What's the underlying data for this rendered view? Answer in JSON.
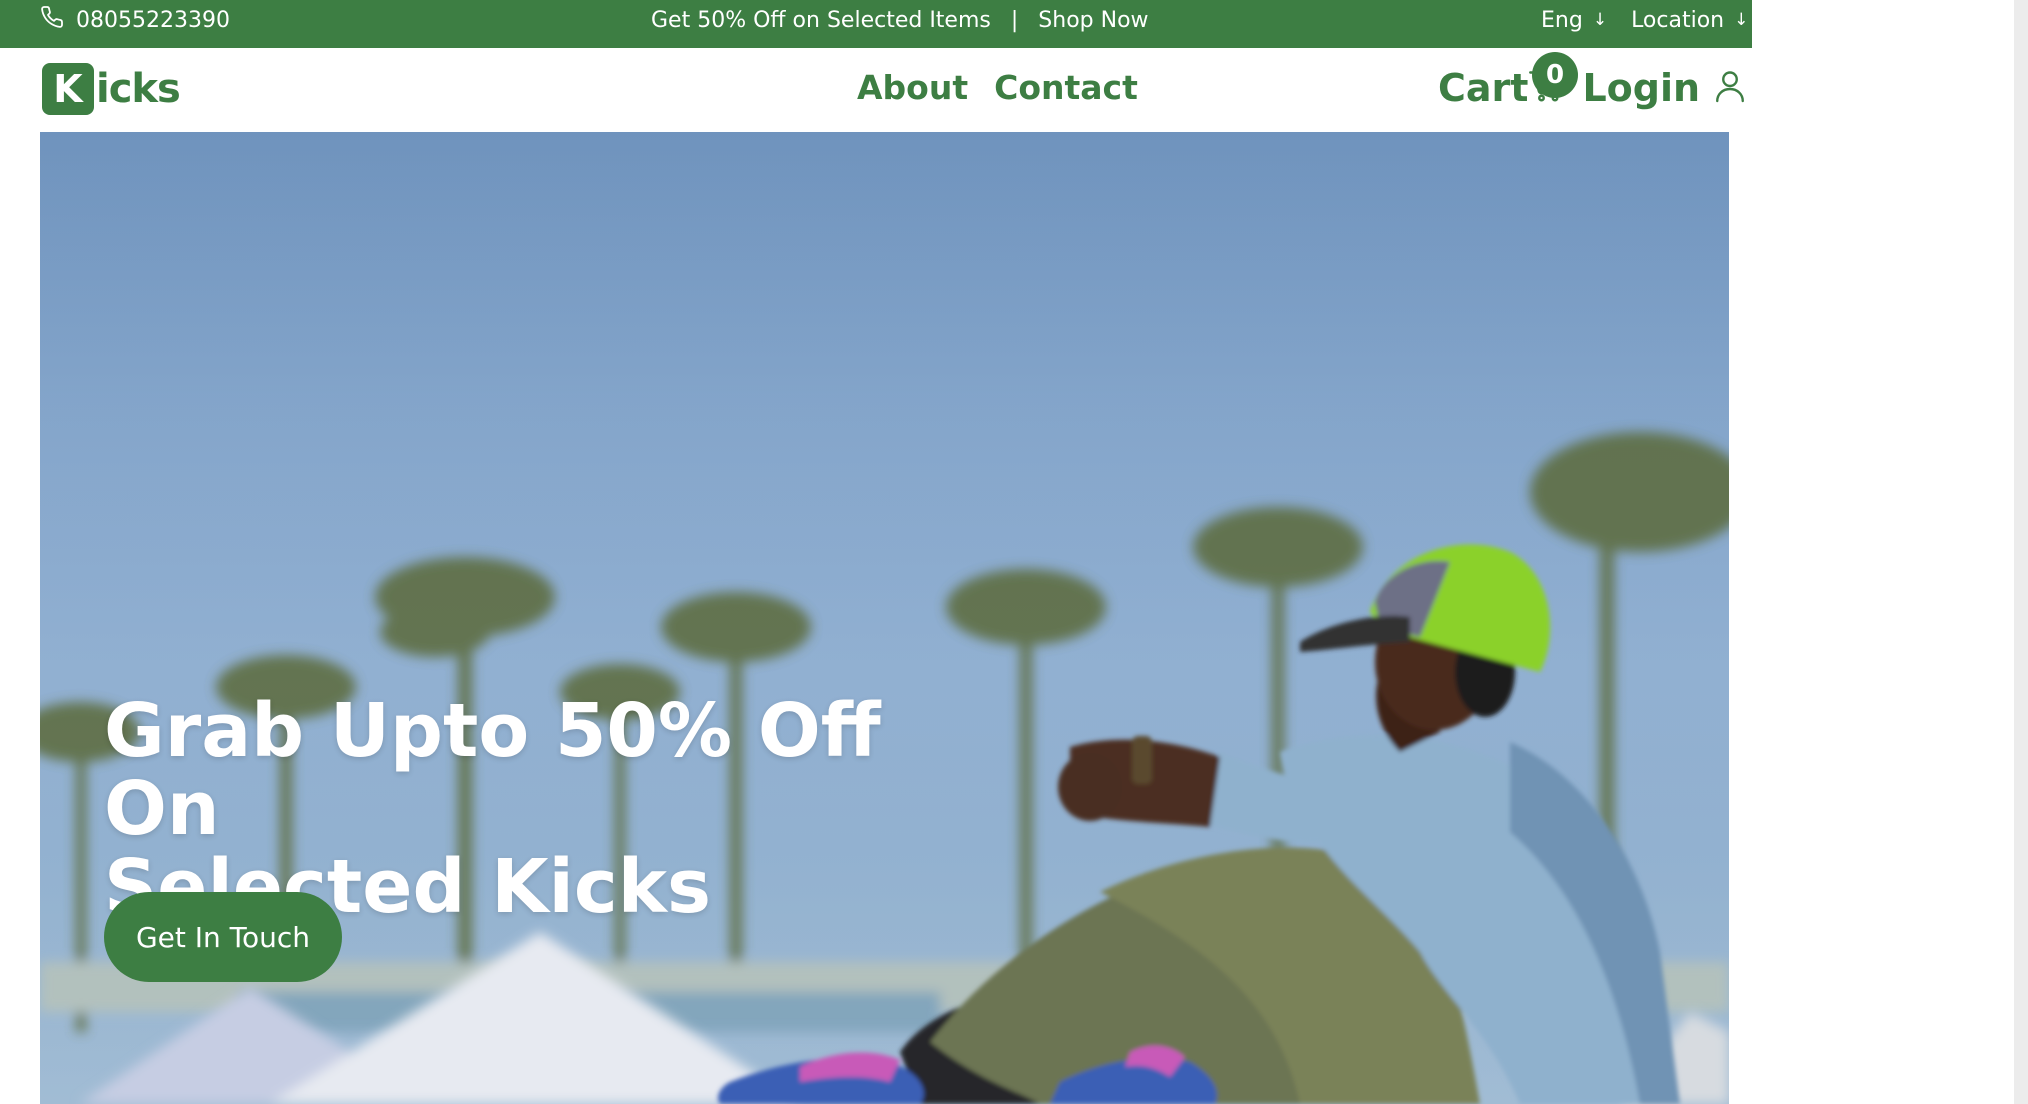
{
  "topbar": {
    "phone": "08055223390",
    "promo_text": "Get 50% Off on Selected Items",
    "separator": "|",
    "promo_link": "Shop Now",
    "language": "Eng",
    "location": "Location",
    "arrow_glyph": "↓"
  },
  "header": {
    "logo_letter": "K",
    "logo_rest": "icks",
    "nav": {
      "about": "About",
      "contact": "Contact"
    },
    "cart_label": "Cart",
    "cart_count": "0",
    "login_label": "Login"
  },
  "hero": {
    "title_line1": "Grab Upto 50% Off On",
    "title_line2": "Selected Kicks",
    "cta_label": "Get In Touch"
  },
  "colors": {
    "brand_green": "#3d7e43",
    "white": "#ffffff"
  },
  "icons": {
    "phone": "phone-icon",
    "cart": "cart-icon",
    "user": "user-icon",
    "arrow": "arrow-down-icon"
  }
}
